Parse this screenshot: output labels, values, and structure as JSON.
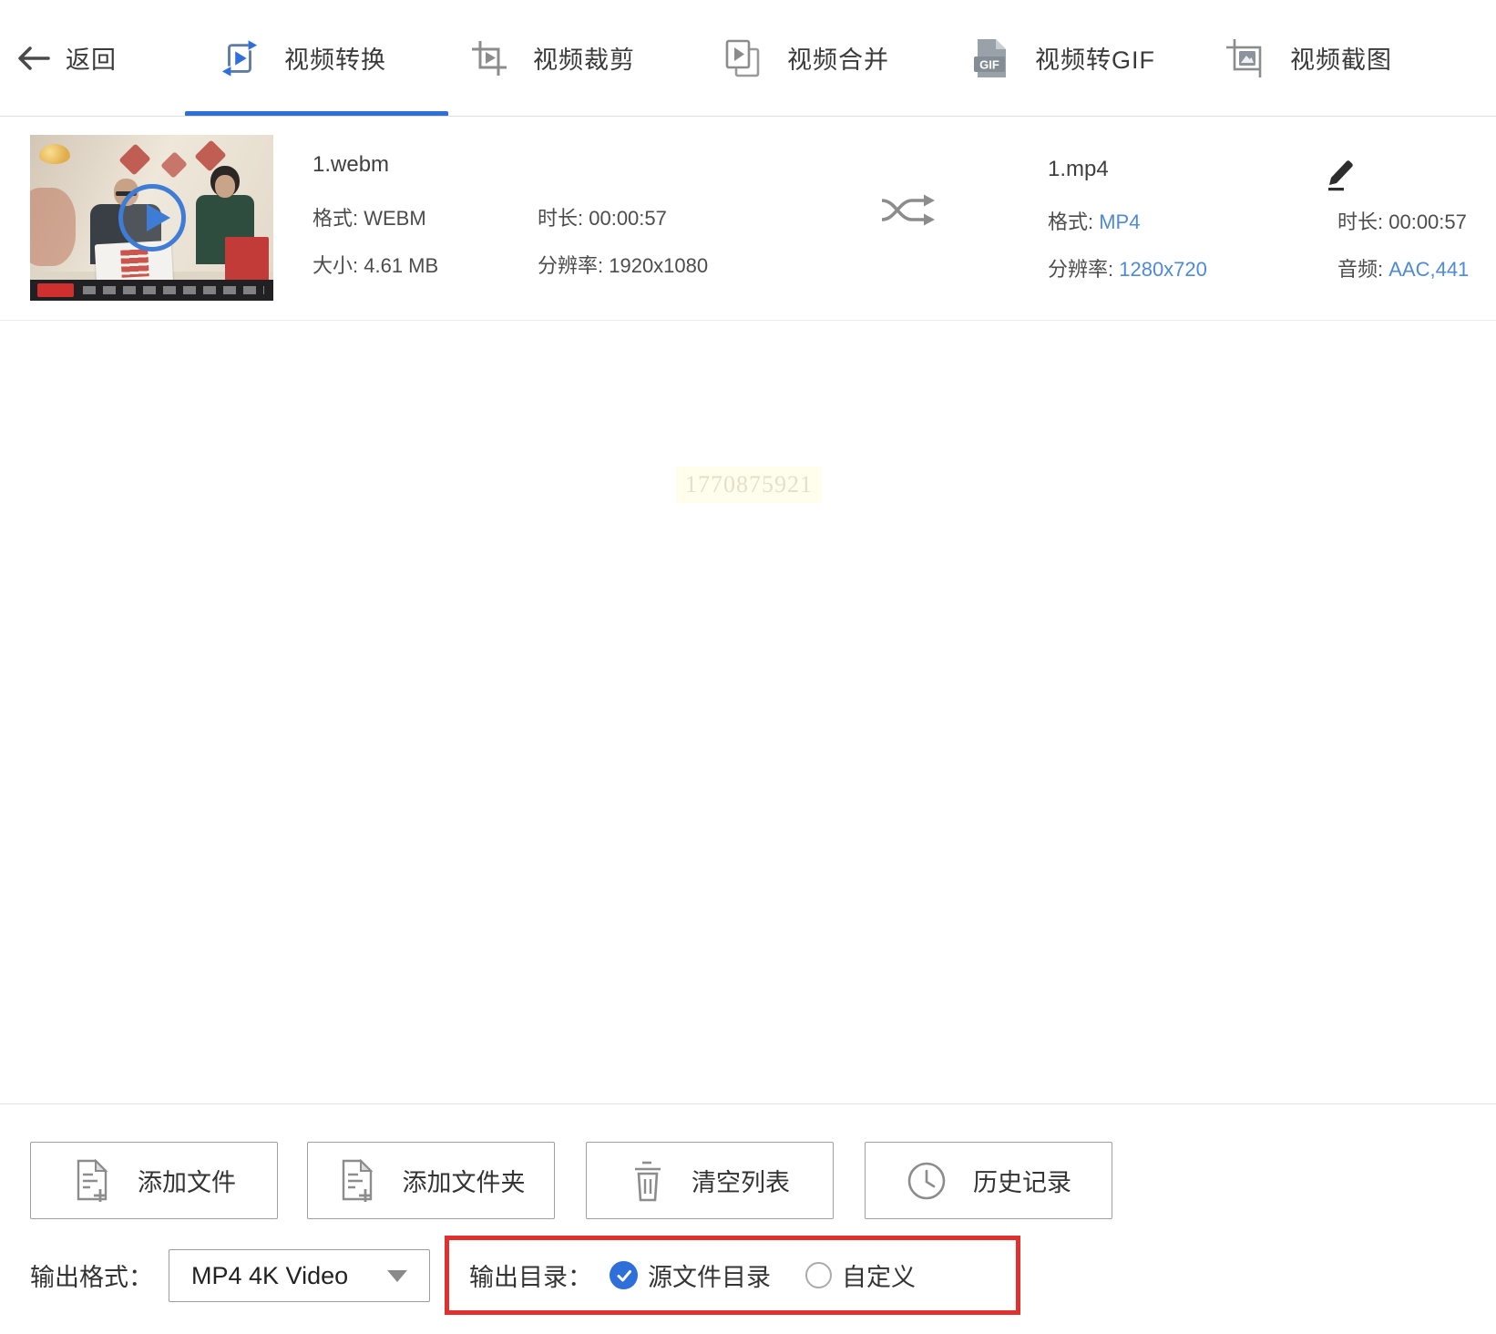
{
  "header": {
    "back_label": "返回",
    "tabs": [
      {
        "label": "视频转换",
        "active": true
      },
      {
        "label": "视频裁剪",
        "active": false
      },
      {
        "label": "视频合并",
        "active": false
      },
      {
        "label": "视频转GIF",
        "active": false
      },
      {
        "label": "视频截图",
        "active": false
      }
    ]
  },
  "file_row": {
    "source": {
      "name": "1.webm",
      "format_label": "格式: ",
      "format": "WEBM",
      "size_label": "大小: ",
      "size": "4.61 MB",
      "duration_label": "时长: ",
      "duration": "00:00:57",
      "resolution_label": "分辨率: ",
      "resolution": "1920x1080"
    },
    "output": {
      "name": "1.mp4",
      "format_label": "格式: ",
      "format": "MP4",
      "resolution_label": "分辨率: ",
      "resolution": "1280x720",
      "duration_label": "时长: ",
      "duration": "00:00:57",
      "audio_label": "音频: ",
      "audio": "AAC,441"
    }
  },
  "watermark": "1770875921",
  "toolbar": {
    "add_file": "添加文件",
    "add_folder": "添加文件夹",
    "clear_list": "清空列表",
    "history": "历史记录"
  },
  "output_bar": {
    "format_label": "输出格式：",
    "format_value": "MP4 4K Video",
    "dir_label": "输出目录：",
    "dir_options": [
      {
        "label": "源文件目录",
        "selected": true
      },
      {
        "label": "自定义",
        "selected": false
      }
    ]
  },
  "colors": {
    "accent": "#2e6fd9",
    "link": "#4e8ad5",
    "hl-red": "#e0312e",
    "nav-text": "#3a3a3a",
    "icon-gray": "#8c8c8c",
    "label": "#4c4c4c"
  }
}
